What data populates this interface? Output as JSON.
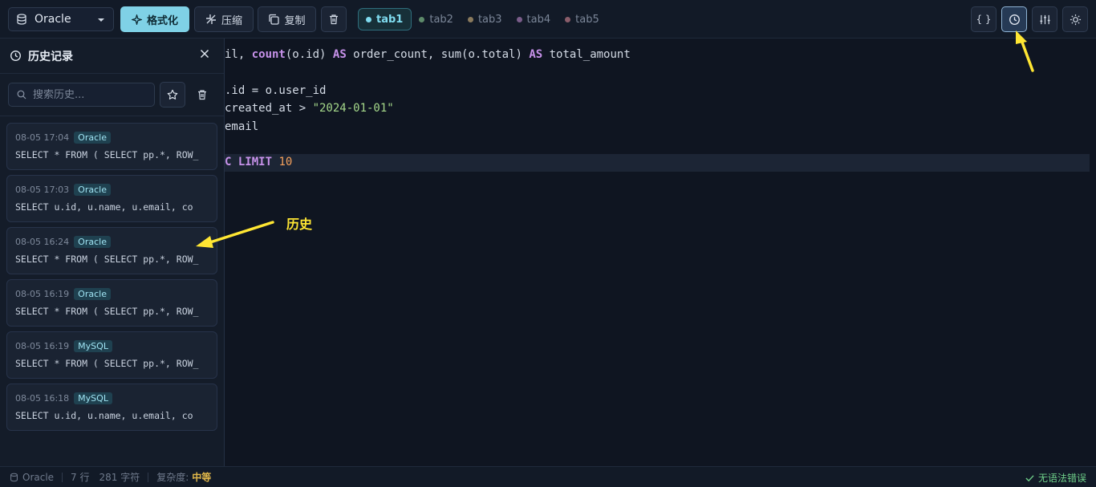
{
  "toolbar": {
    "database": "Oracle",
    "format_label": "格式化",
    "compress_label": "压缩",
    "copy_label": "复制",
    "tabs": [
      {
        "label": "tab1",
        "color": "#7fdcef",
        "active": true
      },
      {
        "label": "tab2",
        "color": "#5d8a6a",
        "active": false
      },
      {
        "label": "tab3",
        "color": "#8a7a5d",
        "active": false
      },
      {
        "label": "tab4",
        "color": "#7a5d8a",
        "active": false
      },
      {
        "label": "tab5",
        "color": "#8a5d6a",
        "active": false
      }
    ],
    "right_buttons": [
      "braces-icon",
      "history-icon",
      "settings-sliders-icon",
      "sun-icon"
    ],
    "json_label": "{ }"
  },
  "sidebar": {
    "title": "历史记录",
    "search_placeholder": "搜索历史...",
    "items": [
      {
        "time": "08-05 17:04",
        "db": "Oracle",
        "sql": "SELECT * FROM ( SELECT pp.*, ROW_"
      },
      {
        "time": "08-05 17:03",
        "db": "Oracle",
        "sql": "SELECT u.id, u.name, u.email, co"
      },
      {
        "time": "08-05 16:24",
        "db": "Oracle",
        "sql": "SELECT * FROM ( SELECT pp.*, ROW_"
      },
      {
        "time": "08-05 16:19",
        "db": "Oracle",
        "sql": "SELECT * FROM ( SELECT pp.*, ROW_"
      },
      {
        "time": "08-05 16:19",
        "db": "MySQL",
        "sql": "SELECT * FROM ( SELECT pp.*, ROW_"
      },
      {
        "time": "08-05 16:18",
        "db": "MySQL",
        "sql": "SELECT u.id, u.name, u.email, co"
      }
    ]
  },
  "editor": {
    "line1": {
      "a": "il, ",
      "fn1": "count",
      "b": "(o.id) ",
      "kw1": "AS",
      "c": " order_count, sum(o.total) ",
      "kw2": "AS",
      "d": " total_amount"
    },
    "line3": ".id = o.user_id",
    "line4": {
      "a": "created_at > ",
      "str": "\"2024-01-01\""
    },
    "line5": "email",
    "line7": {
      "a": "C ",
      "kw": "LIMIT",
      "sp": " ",
      "num": "10"
    }
  },
  "status": {
    "database": "Oracle",
    "lines": "7 行",
    "chars": "281 字符",
    "complexity_label": "复杂度:",
    "complexity_value": "中等",
    "syntax_ok": "无语法错误"
  },
  "annotations": {
    "history_label": "历史"
  }
}
